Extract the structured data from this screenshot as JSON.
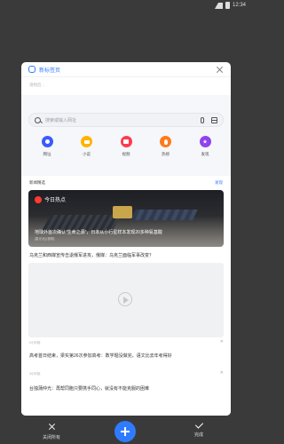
{
  "status_bar": {
    "time": "12:34"
  },
  "tab": {
    "title": "新标签页",
    "loading_text": "请稍后..."
  },
  "search": {
    "placeholder": "搜索或输入网址"
  },
  "quick_links": [
    {
      "label": "网址",
      "color": "#3d5afe"
    },
    {
      "label": "小说",
      "color": "#ffb300"
    },
    {
      "label": "视频",
      "color": "#ff3b4d"
    },
    {
      "label": "热榜",
      "color": "#ff7a1a"
    },
    {
      "label": "发现",
      "color": "#8e44ec"
    }
  ],
  "news": {
    "section_title": "新闻精选",
    "more_label": "发现",
    "hot": {
      "badge": "今日热点",
      "headline": "地球外首次确认“生命之源”，日本从小行星样本发现20多种氨基酸",
      "source": "[星光北] [视频]"
    },
    "items": [
      {
        "title": "乌克兰和西媒宣传击退俄军进攻，俄媒：乌克兰面临军事改变？"
      },
      {
        "title": "高考首日结束，梁实第26次参加高考：数学题没做完，语文比去年考得好"
      },
      {
        "title": "台独蒲仲光：再帮同胞只要携手同心，就没有不能克服的困难"
      }
    ],
    "meta_1": "2小时前",
    "meta_2": "3小时前"
  },
  "bottom_bar": {
    "close_all": "关闭所有",
    "done": "完成"
  }
}
